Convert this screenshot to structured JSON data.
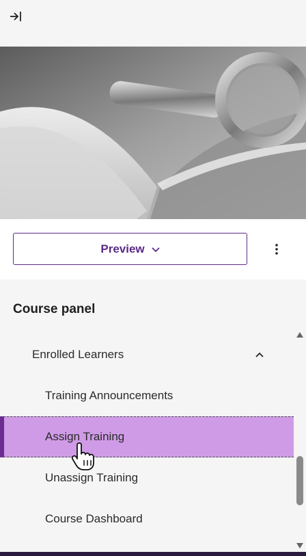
{
  "preview": {
    "label": "Preview"
  },
  "panel": {
    "title": "Course panel",
    "items": [
      {
        "label": "Enrolled Learners",
        "level": 1,
        "expanded": true
      },
      {
        "label": "Training Announcements",
        "level": 2
      },
      {
        "label": "Assign Training",
        "level": 2,
        "active": true
      },
      {
        "label": "Unassign Training",
        "level": 2
      },
      {
        "label": "Course Dashboard",
        "level": 2
      }
    ]
  },
  "icons": {
    "collapse": "collapse-panel-icon",
    "preview_chevron": "chevron-down-icon",
    "more": "more-vertical-icon",
    "group_chevron": "chevron-up-icon",
    "cursor": "hand-pointer-cursor"
  },
  "colors": {
    "accent": "#5b2a86",
    "active_bg": "#cf9be6",
    "active_bar": "#6b2c91"
  }
}
